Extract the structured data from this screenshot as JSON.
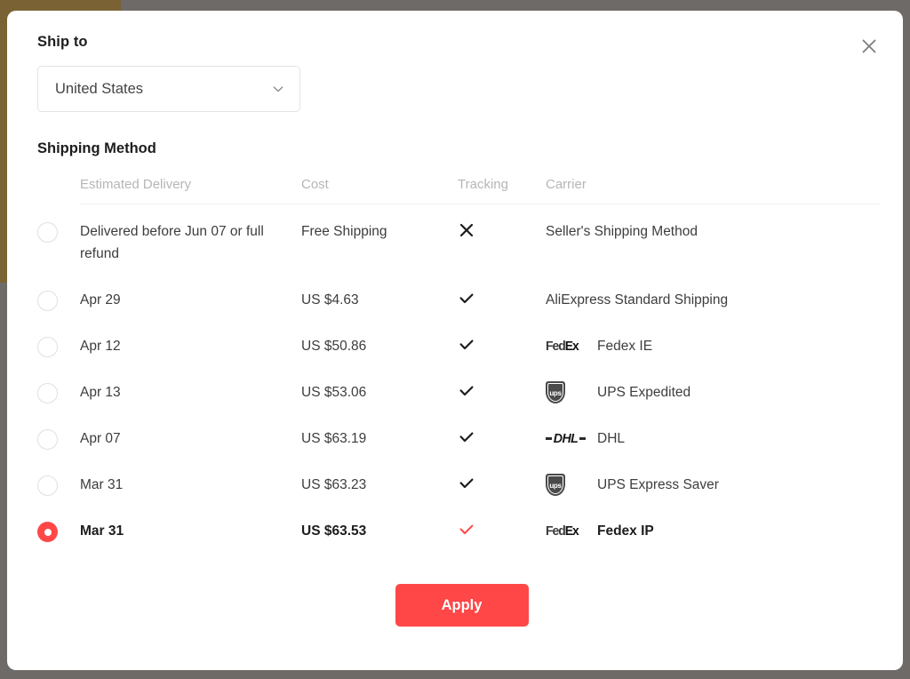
{
  "theme": {
    "accent": "#ff4747",
    "text": "#3d3d3d",
    "muted": "#b6b6b6",
    "backdrop": "#6e6a68"
  },
  "modal": {
    "close_icon": "close-icon",
    "ship_to": {
      "label": "Ship to",
      "country_value": "United States",
      "chevron_icon": "chevron-down-icon"
    },
    "shipping": {
      "label": "Shipping Method",
      "columns": [
        "Estimated Delivery",
        "Cost",
        "Tracking",
        "Carrier"
      ],
      "rows": [
        {
          "selected": false,
          "delivery": "Delivered before Jun 07 or full refund",
          "cost": "Free Shipping",
          "tracking": "no",
          "tracking_icon": "close-icon",
          "logo": "none",
          "carrier": "Seller's Shipping Method"
        },
        {
          "selected": false,
          "delivery": "Apr 29",
          "cost": "US $4.63",
          "tracking": "yes",
          "tracking_icon": "check-icon",
          "logo": "none",
          "carrier": "AliExpress Standard Shipping"
        },
        {
          "selected": false,
          "delivery": "Apr 12",
          "cost": "US $50.86",
          "tracking": "yes",
          "tracking_icon": "check-icon",
          "logo": "fedex",
          "carrier": "Fedex IE"
        },
        {
          "selected": false,
          "delivery": "Apr 13",
          "cost": "US $53.06",
          "tracking": "yes",
          "tracking_icon": "check-icon",
          "logo": "ups",
          "carrier": "UPS Expedited"
        },
        {
          "selected": false,
          "delivery": "Apr 07",
          "cost": "US $63.19",
          "tracking": "yes",
          "tracking_icon": "check-icon",
          "logo": "dhl",
          "carrier": "DHL"
        },
        {
          "selected": false,
          "delivery": "Mar 31",
          "cost": "US $63.23",
          "tracking": "yes",
          "tracking_icon": "check-icon",
          "logo": "ups",
          "carrier": "UPS Express Saver"
        },
        {
          "selected": true,
          "delivery": "Mar 31",
          "cost": "US $63.53",
          "tracking": "yes",
          "tracking_icon": "check-icon",
          "logo": "fedex",
          "carrier": "Fedex IP"
        }
      ]
    },
    "apply_label": "Apply"
  },
  "logo_text": {
    "fedex_fed": "Fed",
    "fedex_ex": "Ex",
    "ups": "ups",
    "dhl": "DHL"
  }
}
